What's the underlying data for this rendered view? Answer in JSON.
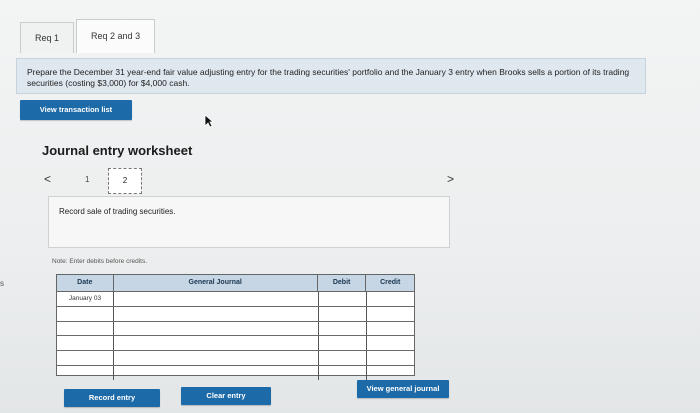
{
  "edge": {
    "text": "s"
  },
  "tabs": [
    {
      "label": "Req 1"
    },
    {
      "label": "Req 2 and 3"
    }
  ],
  "instruction": {
    "text": "Prepare the December 31 year-end fair value adjusting entry for the trading securities' portfolio and the January 3 entry when Brooks sells a portion of its trading securities (costing $3,000) for $4,000 cash."
  },
  "buttons": {
    "view_transaction_list": "View transaction list",
    "record_entry": "Record entry",
    "clear_entry": "Clear entry",
    "view_general_journal": "View general journal"
  },
  "worksheet": {
    "title": "Journal entry worksheet",
    "pages": [
      "1",
      "2"
    ],
    "current_page": "2",
    "prev_symbol": "<",
    "next_symbol": ">",
    "description": "Record sale of trading securities."
  },
  "note": "Note: Enter debits before credits.",
  "journal": {
    "headers": {
      "date": "Date",
      "general_journal": "General Journal",
      "debit": "Debit",
      "credit": "Credit"
    },
    "rows": [
      {
        "date": "January 03",
        "account": "",
        "debit": "",
        "credit": ""
      },
      {
        "date": "",
        "account": "",
        "debit": "",
        "credit": ""
      },
      {
        "date": "",
        "account": "",
        "debit": "",
        "credit": ""
      },
      {
        "date": "",
        "account": "",
        "debit": "",
        "credit": ""
      },
      {
        "date": "",
        "account": "",
        "debit": "",
        "credit": ""
      },
      {
        "date": "",
        "account": "",
        "debit": "",
        "credit": ""
      }
    ]
  },
  "colors": {
    "accent": "#1d6aa8",
    "header_bg": "#c6d6e4",
    "instruction_bg": "#dfe8ef"
  }
}
